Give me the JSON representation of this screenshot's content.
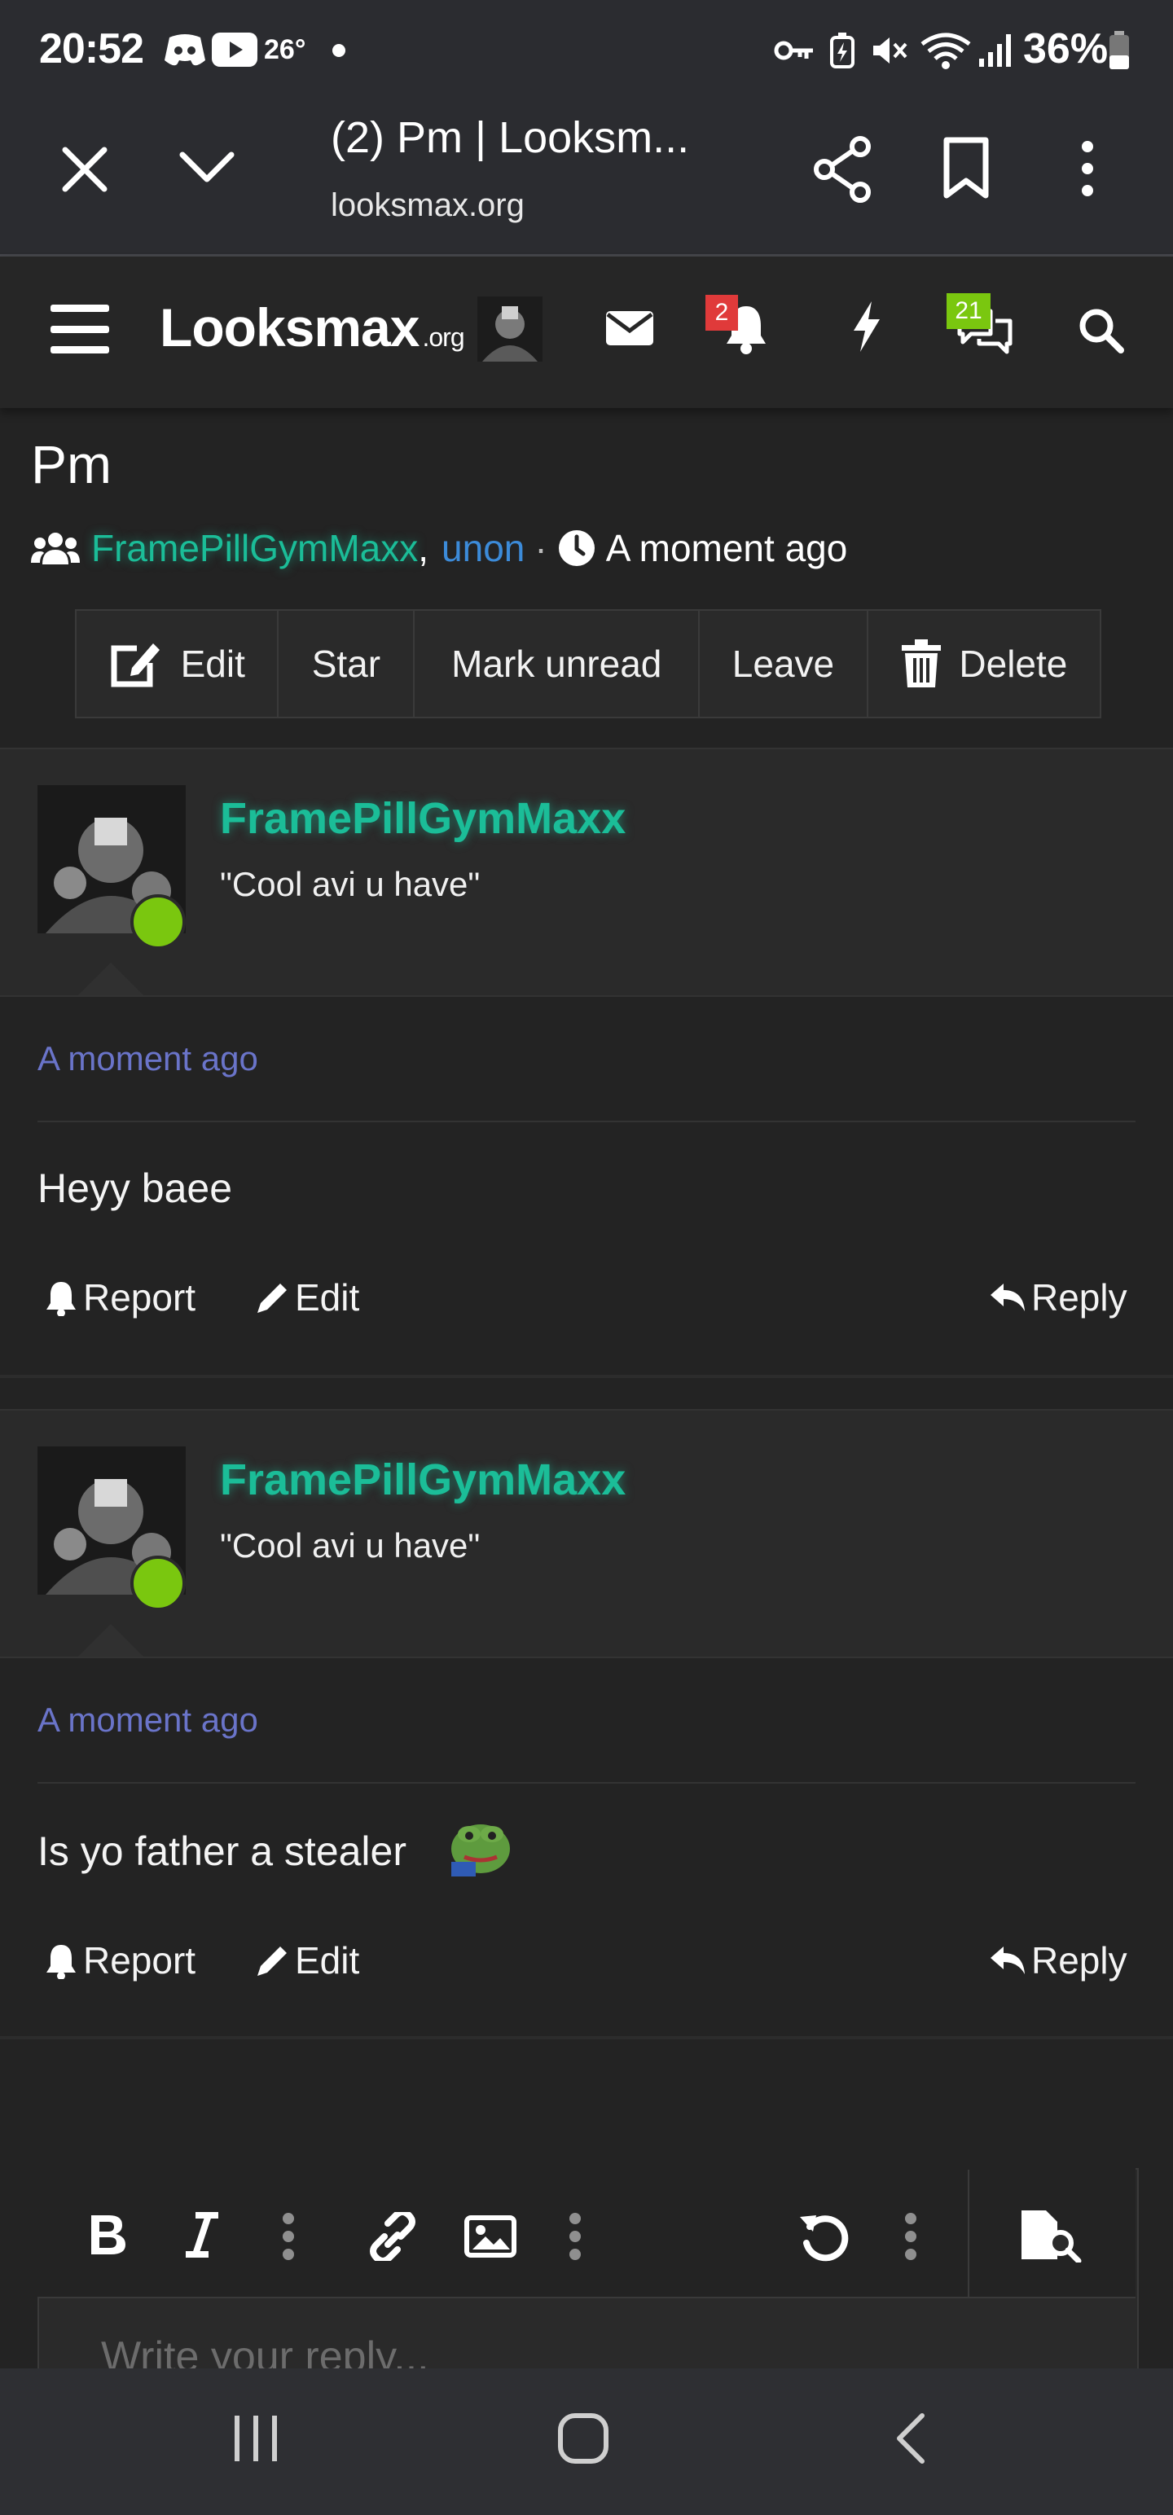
{
  "status_bar": {
    "time": "20:52",
    "temperature": "26°",
    "battery": "36%"
  },
  "browser": {
    "tab_title": "(2) Pm | Looksm...",
    "url": "looksmax.org"
  },
  "site_header": {
    "logo_main": "Looksmax",
    "logo_suffix": ".org",
    "alerts_count": "2",
    "conversations_count": "21"
  },
  "conversation": {
    "title": "Pm",
    "participant_1": "FramePillGymMaxx",
    "participant_2": "unon",
    "separator": ",",
    "dot": "·",
    "time": "A moment ago",
    "actions": {
      "edit": "Edit",
      "star": "Star",
      "mark_unread": "Mark unread",
      "leave": "Leave",
      "delete": "Delete"
    }
  },
  "messages": [
    {
      "username": "FramePillGymMaxx",
      "user_title": "\"Cool avi u have\"",
      "time": "A moment ago",
      "body": "Heyy baee",
      "report": "Report",
      "edit": "Edit",
      "reply": "Reply"
    },
    {
      "username": "FramePillGymMaxx",
      "user_title": "\"Cool avi u have\"",
      "time": "A moment ago",
      "body": "Is yo father a stealer",
      "report": "Report",
      "edit": "Edit",
      "reply": "Reply"
    }
  ],
  "editor": {
    "placeholder": "Write your reply..."
  },
  "colors": {
    "username": "#1bbd98",
    "link": "#3c8bd9",
    "timestamp": "#6a74c9",
    "online": "#7ac70f",
    "alert_badge": "#e03a3a",
    "conversation_badge": "#7ac70f"
  }
}
